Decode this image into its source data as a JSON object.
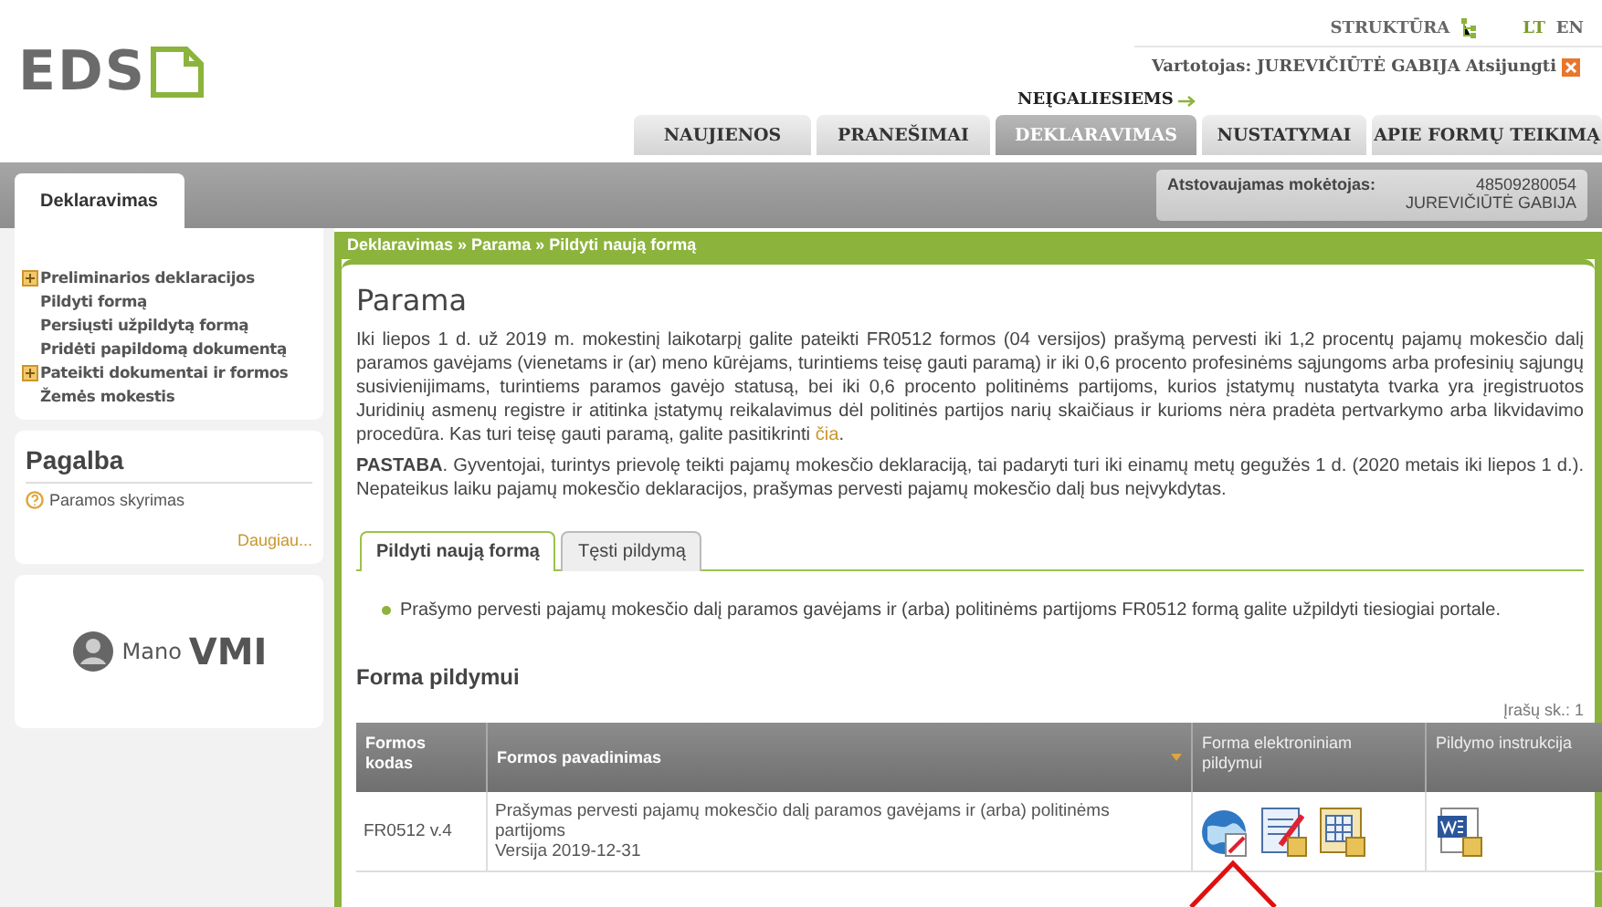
{
  "header": {
    "logo": "EDS",
    "structure_link": "STRUKTŪRA",
    "languages": [
      {
        "label": "LT",
        "selected": true
      },
      {
        "label": "EN",
        "selected": false
      }
    ],
    "user_label": "Vartotojas:",
    "user_name": "JUREVIČIŪTĖ GABIJA",
    "logout": "Atsijungti",
    "accessibility_link": "NEĮGALIESIEMS"
  },
  "nav_tabs": [
    {
      "label": "NAUJIENOS",
      "selected": false
    },
    {
      "label": "PRANEŠIMAI",
      "selected": false
    },
    {
      "label": "DEKLARAVIMAS",
      "selected": true
    },
    {
      "label": "NUSTATYMAI",
      "selected": false
    },
    {
      "label": "APIE FORMŲ TEIKIMĄ",
      "selected": false
    }
  ],
  "subbar": {
    "tab": "Deklaravimas",
    "payer_label": "Atstovaujamas mokėtojas:",
    "payer_code": "48509280054",
    "payer_name": "JUREVIČIŪTĖ GABIJA"
  },
  "sidebar": {
    "items": [
      {
        "label": "Preliminarios deklaracijos",
        "kind": "group",
        "expanded": false
      },
      {
        "label": "Pildyti formą",
        "kind": "link"
      },
      {
        "label": "Persiųsti užpildytą formą",
        "kind": "link"
      },
      {
        "label": "Pridėti papildomą dokumentą",
        "kind": "link"
      },
      {
        "label": "Pateikti dokumentai ir formos",
        "kind": "group",
        "expanded": false
      },
      {
        "label": "Žemės mokestis",
        "kind": "link"
      }
    ],
    "help": {
      "title": "Pagalba",
      "items": [
        "Paramos skyrimas"
      ],
      "more": "Daugiau..."
    },
    "promo": {
      "word1": "Mano",
      "word2": "VMI"
    }
  },
  "breadcrumb": "Deklaravimas » Parama » Pildyti naują formą",
  "page": {
    "title": "Parama",
    "intro": "Iki liepos 1 d. už 2019 m. mokestinį laikotarpį galite pateikti FR0512 formos (04 versijos) prašymą pervesti iki 1,2 procentų pajamų mokesčio dalį paramos gavėjams (vienetams ir (ar) meno kūrėjams, turintiems teisę gauti paramą) ir iki 0,6 procento profesinėms sąjungoms arba profesinių sąjungų susivienijimams, turintiems paramos gavėjo statusą, bei iki 0,6 procento politinėms partijoms, kurios įstatymų nustatyta tvarka yra įregistruotos Juridinių asmenų registre ir atitinka įstatymų reikalavimus dėl politinės partijos narių skaičiaus ir kurioms nėra pradėta pertvarkymo arba likvidavimo procedūra. Kas turi teisę gauti paramą, galite pasitikrinti",
    "intro_link": "čia",
    "intro_end": ".",
    "note": "**PASTABA**. Gyventojai, turintys prievolę teikti pajamų mokesčio deklaraciją, tai padaryti turi iki einamų metų gegužės 1 d. (2020 metais iki liepos 1 d.). Nepateikus laiku pajamų mokesčio deklaracijos, prašymas pervesti pajamų mokesčio dalį bus neįvykdytas."
  },
  "content_tabs": [
    {
      "label": "Pildyti naują formą",
      "selected": true
    },
    {
      "label": "Tęsti pildymą",
      "selected": false
    }
  ],
  "notice": "Prašymo pervesti pajamų mokesčio dalį paramos gavėjams ir (arba) politinėms partijoms FR0512 formą galite užpildyti tiesiogiai portale.",
  "section_title": "Forma pildymui",
  "record_count": "Įrašų sk.: 1",
  "table": {
    "columns": [
      "Formos kodas",
      "Formos pavadinimas",
      "Forma elektroniniam pildymui",
      "Pildymo instrukcija"
    ],
    "rows": [
      {
        "code": "FR0512 v.4",
        "name": "Prašymas pervesti pajamų mokesčio dalį paramos gavėjams ir (arba) politinėms partijoms",
        "version": "Versija 2019-12-31"
      }
    ]
  }
}
